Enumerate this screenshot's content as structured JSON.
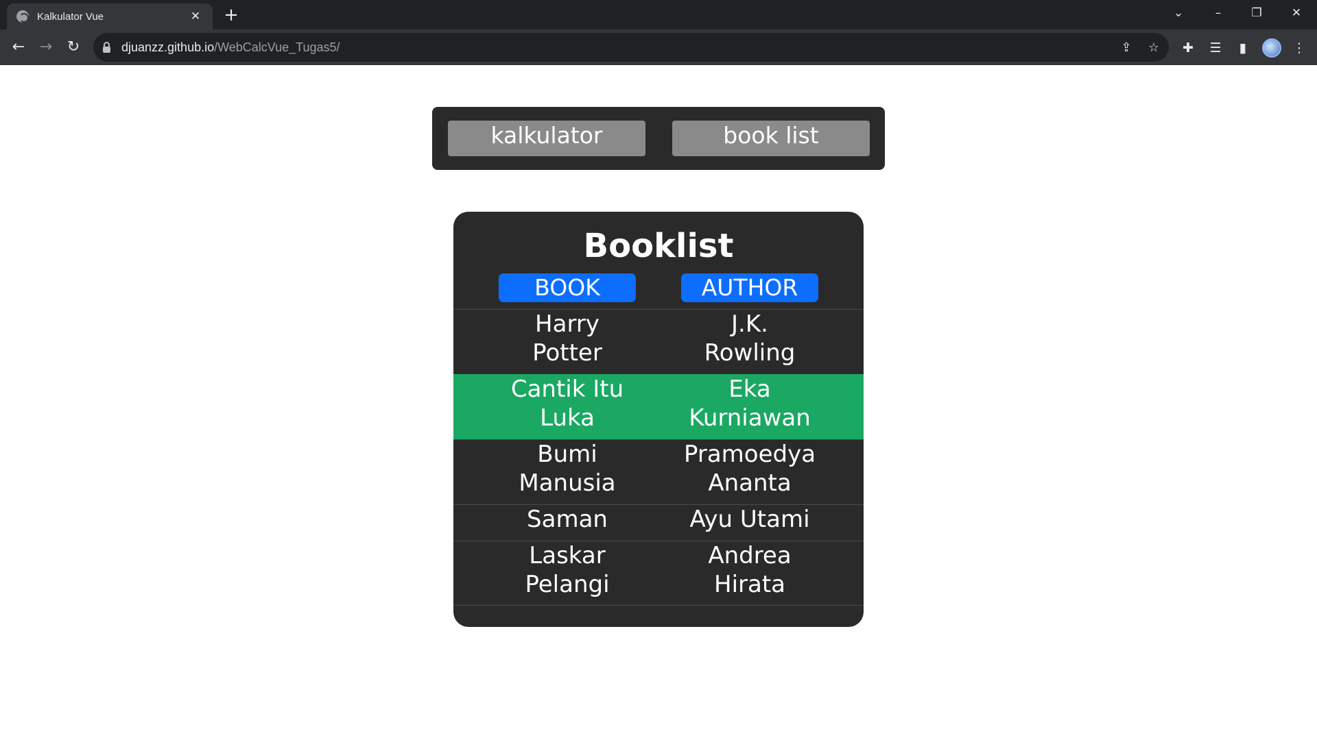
{
  "browser": {
    "tab_title": "Kalkulator Vue",
    "url_host": "djuanzz.github.io",
    "url_path": "/WebCalcVue_Tugas5/"
  },
  "nav": {
    "calculator_label": "kalkulator",
    "booklist_label": "book list"
  },
  "booklist": {
    "title": "Booklist",
    "columns": [
      "BOOK",
      "AUTHOR"
    ],
    "rows": [
      {
        "book": [
          "Harry",
          "Potter"
        ],
        "author": [
          "J.K.",
          "Rowling"
        ],
        "highlight": false
      },
      {
        "book": [
          "Cantik Itu",
          "Luka"
        ],
        "author": [
          "Eka",
          "Kurniawan"
        ],
        "highlight": true
      },
      {
        "book": [
          "Bumi",
          "Manusia"
        ],
        "author": [
          "Pramoedya",
          "Ananta"
        ],
        "highlight": false
      },
      {
        "book": [
          "Saman"
        ],
        "author": [
          "Ayu Utami"
        ],
        "highlight": false
      },
      {
        "book": [
          "Laskar",
          "Pelangi"
        ],
        "author": [
          "Andrea",
          "Hirata"
        ],
        "highlight": false
      }
    ]
  },
  "colors": {
    "header_button": "#0d6efd",
    "highlight_row": "#1aa863",
    "card_background": "#2a2a2a",
    "nav_button": "#8a8a8a"
  }
}
